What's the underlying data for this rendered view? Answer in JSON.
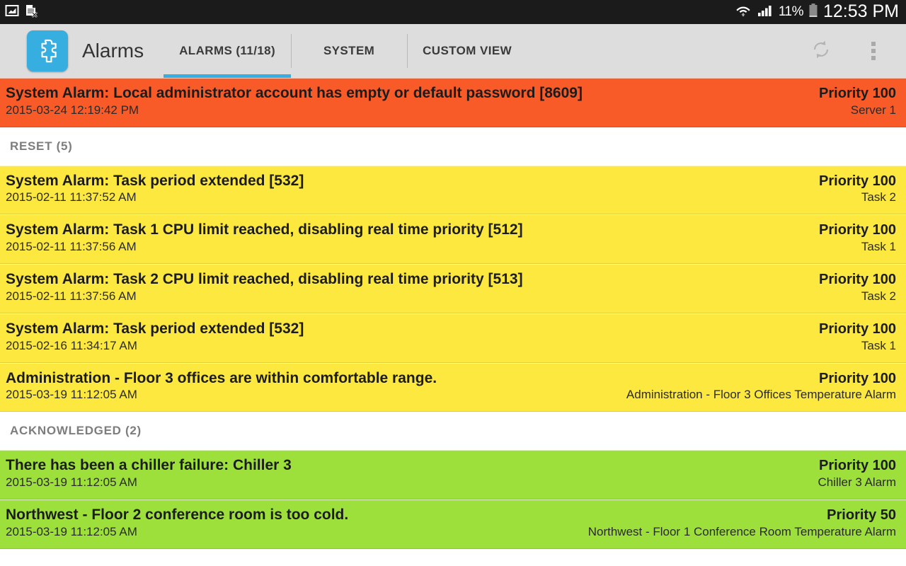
{
  "status_bar": {
    "left_icons": [
      "screenshot-icon",
      "document-error-icon"
    ],
    "right_icons": [
      "wifi-icon",
      "cell-signal-icon",
      "battery-icon"
    ],
    "battery_percent": "11%",
    "time": "12:53 PM"
  },
  "app_bar": {
    "app_icon": "puzzle-piece-icon",
    "title": "Alarms",
    "tabs": [
      {
        "label": "ALARMS (11/18)",
        "active": true
      },
      {
        "label": "SYSTEM",
        "active": false
      },
      {
        "label": "CUSTOM VIEW",
        "active": false
      }
    ],
    "actions": [
      {
        "name": "refresh-button",
        "icon": "refresh-icon"
      },
      {
        "name": "overflow-menu-button",
        "icon": "more-vertical-icon"
      }
    ]
  },
  "colors": {
    "accent": "#36aee0",
    "critical": "#f95b28",
    "reset": "#fce83e",
    "acknowledged": "#9de03c",
    "appbar_bg": "#dddddd",
    "statusbar_bg": "#1b1b1b"
  },
  "sections": [
    {
      "header": null,
      "severity": "critical",
      "rows": [
        {
          "title": "System Alarm: Local administrator account has empty or default password [8609]",
          "priority": "Priority 100",
          "time": "2015-03-24 12:19:42 PM",
          "source": "Server 1"
        }
      ]
    },
    {
      "header": "RESET (5)",
      "severity": "reset",
      "rows": [
        {
          "title": "System Alarm: Task period extended [532]",
          "priority": "Priority 100",
          "time": "2015-02-11 11:37:52 AM",
          "source": "Task 2"
        },
        {
          "title": "System Alarm: Task 1 CPU limit reached, disabling real time priority [512]",
          "priority": "Priority 100",
          "time": "2015-02-11 11:37:56 AM",
          "source": "Task 1"
        },
        {
          "title": "System Alarm: Task 2 CPU limit reached, disabling real time priority [513]",
          "priority": "Priority 100",
          "time": "2015-02-11 11:37:56 AM",
          "source": "Task 2"
        },
        {
          "title": "System Alarm: Task period extended [532]",
          "priority": "Priority 100",
          "time": "2015-02-16 11:34:17 AM",
          "source": "Task 1"
        },
        {
          "title": "Administration - Floor 3 offices are within comfortable range.",
          "priority": "Priority 100",
          "time": "2015-03-19 11:12:05 AM",
          "source": "Administration - Floor 3 Offices Temperature Alarm"
        }
      ]
    },
    {
      "header": "ACKNOWLEDGED (2)",
      "severity": "ack",
      "rows": [
        {
          "title": "There has been a chiller failure: Chiller 3",
          "priority": "Priority 100",
          "time": "2015-03-19 11:12:05 AM",
          "source": "Chiller 3 Alarm"
        },
        {
          "title": "Northwest - Floor 2 conference room is too cold.",
          "priority": "Priority 50",
          "time": "2015-03-19 11:12:05 AM",
          "source": "Northwest - Floor 1 Conference Room Temperature Alarm"
        }
      ]
    }
  ]
}
